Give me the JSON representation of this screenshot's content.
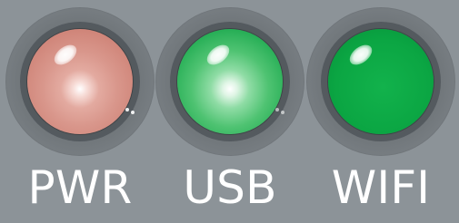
{
  "indicators": [
    {
      "label": "PWR",
      "lens_color": "#d9978c",
      "state": "on"
    },
    {
      "label": "USB",
      "lens_color": "#4fc372",
      "state": "on"
    },
    {
      "label": "WIFI",
      "lens_color": "#0ba643",
      "state": "on"
    }
  ],
  "panel_color": "#8c9398",
  "text_color": "#ffffff"
}
